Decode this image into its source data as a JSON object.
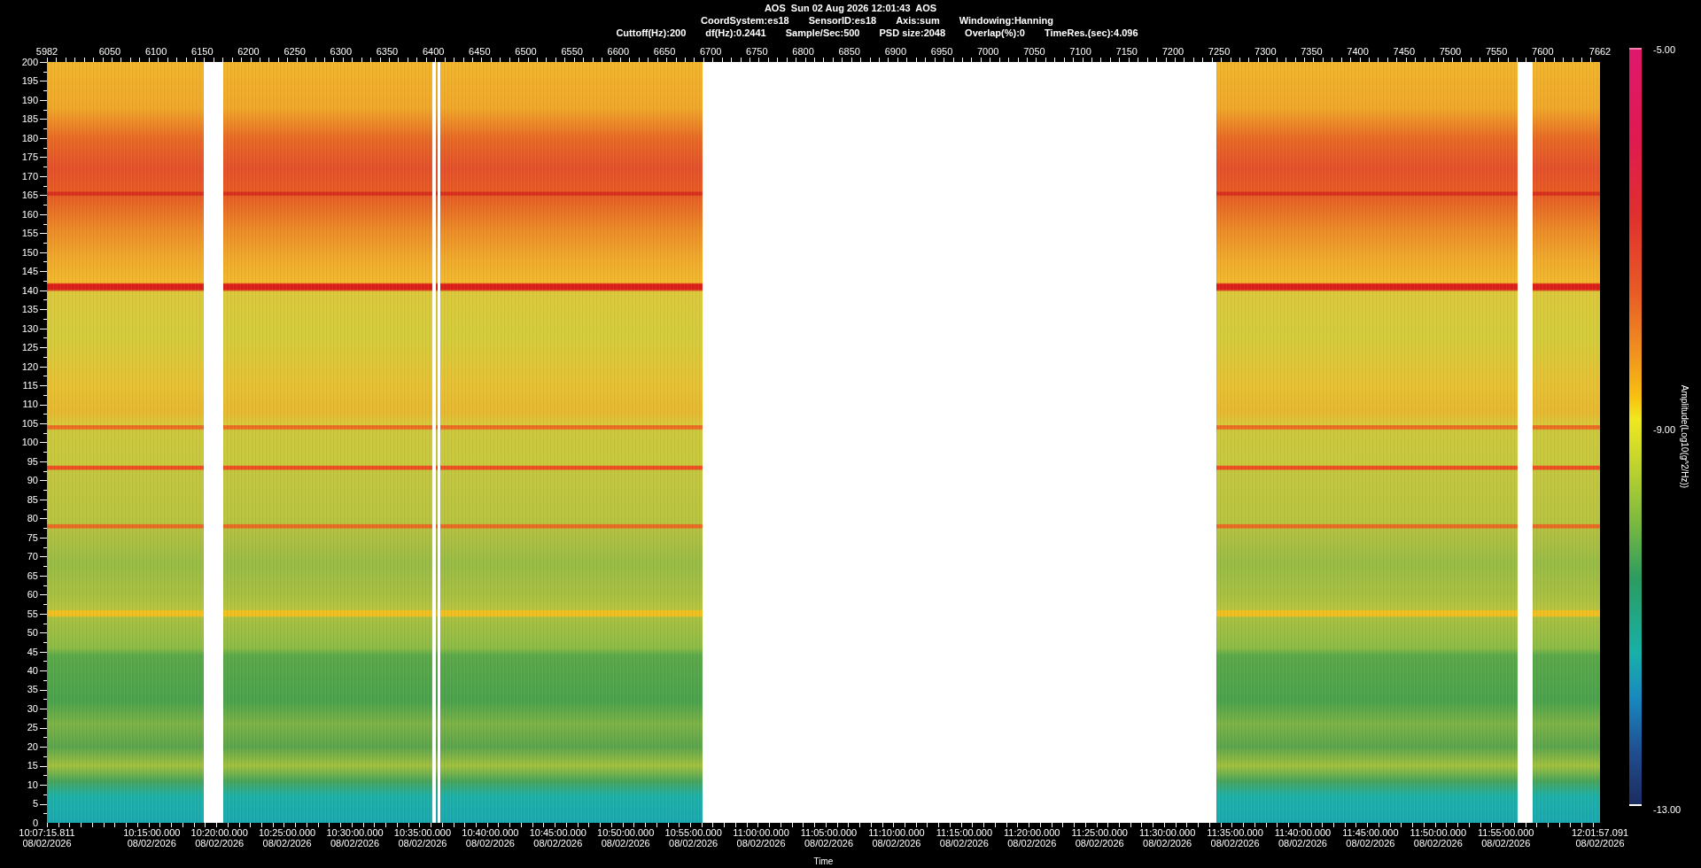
{
  "header": {
    "title": "AOS  Sun 02 Aug 2026 12:01:43  AOS",
    "settings": [
      "CoordSystem:es18",
      "SensorID:es18",
      "Axis:sum",
      "Windowing:Hanning"
    ],
    "parameters": [
      "Cuttoff(Hz):200",
      "df(Hz):0.2441",
      "Sample/Sec:500",
      "PSD size:2048",
      "Overlap(%):0",
      "TimeRes.(sec):4.096"
    ]
  },
  "top_axis": {
    "ticks": [
      "5982",
      "6050",
      "6100",
      "6150",
      "6200",
      "6250",
      "6300",
      "6350",
      "6400",
      "6450",
      "6500",
      "6550",
      "6600",
      "6650",
      "6700",
      "6750",
      "6800",
      "6850",
      "6900",
      "6950",
      "7000",
      "7050",
      "7100",
      "7150",
      "7200",
      "7250",
      "7300",
      "7350",
      "7400",
      "7450",
      "7500",
      "7550",
      "7600",
      "7662"
    ]
  },
  "y_axis": {
    "ticks": [
      "200",
      "195",
      "190",
      "185",
      "180",
      "175",
      "170",
      "165",
      "160",
      "155",
      "150",
      "145",
      "140",
      "135",
      "130",
      "125",
      "120",
      "115",
      "110",
      "105",
      "100",
      "95",
      "90",
      "85",
      "80",
      "75",
      "70",
      "65",
      "60",
      "55",
      "50",
      "45",
      "40",
      "35",
      "30",
      "25",
      "20",
      "15",
      "10",
      "5",
      "0"
    ]
  },
  "x_axis": {
    "title": "Time",
    "ticks": [
      {
        "time": "10:07:15.811",
        "date": "08/02/2026"
      },
      {
        "time": "10:15:00.000",
        "date": "08/02/2026"
      },
      {
        "time": "10:20:00.000",
        "date": "08/02/2026"
      },
      {
        "time": "10:25:00.000",
        "date": "08/02/2026"
      },
      {
        "time": "10:30:00.000",
        "date": "08/02/2026"
      },
      {
        "time": "10:35:00.000",
        "date": "08/02/2026"
      },
      {
        "time": "10:40:00.000",
        "date": "08/02/2026"
      },
      {
        "time": "10:45:00.000",
        "date": "08/02/2026"
      },
      {
        "time": "10:50:00.000",
        "date": "08/02/2026"
      },
      {
        "time": "10:55:00.000",
        "date": "08/02/2026"
      },
      {
        "time": "11:00:00.000",
        "date": "08/02/2026"
      },
      {
        "time": "11:05:00.000",
        "date": "08/02/2026"
      },
      {
        "time": "11:10:00.000",
        "date": "08/02/2026"
      },
      {
        "time": "11:15:00.000",
        "date": "08/02/2026"
      },
      {
        "time": "11:20:00.000",
        "date": "08/02/2026"
      },
      {
        "time": "11:25:00.000",
        "date": "08/02/2026"
      },
      {
        "time": "11:30:00.000",
        "date": "08/02/2026"
      },
      {
        "time": "11:35:00.000",
        "date": "08/02/2026"
      },
      {
        "time": "11:40:00.000",
        "date": "08/02/2026"
      },
      {
        "time": "11:45:00.000",
        "date": "08/02/2026"
      },
      {
        "time": "11:50:00.000",
        "date": "08/02/2026"
      },
      {
        "time": "11:55:00.000",
        "date": "08/02/2026"
      },
      {
        "time": "12:01:57.091",
        "date": "08/02/2026"
      }
    ]
  },
  "color_scale": {
    "title": "Amplitude(Log10(g^2/Hz))",
    "max": "-5.00",
    "mid": "-9.00",
    "min": "-13.00"
  }
}
